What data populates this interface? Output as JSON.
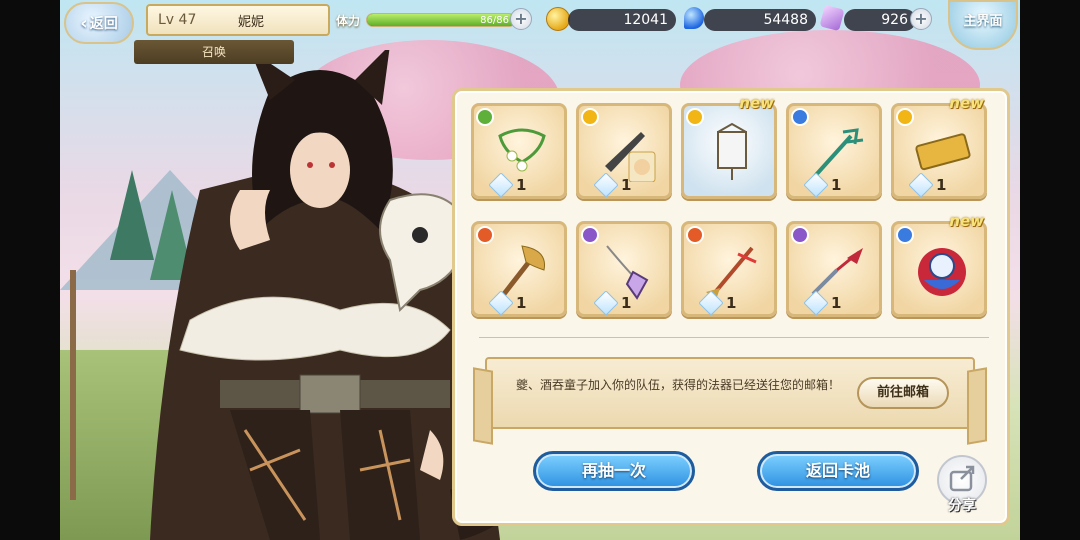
{
  "topbar": {
    "back_label": "返回",
    "level": "Lv 47",
    "player_name": "妮妮",
    "screen_tab": "召唤",
    "stamina_label": "体力",
    "stamina_value": "86/86",
    "stamina_fraction": 1.0,
    "gold": "12041",
    "blue_gems": "54488",
    "crystals": "926",
    "home_label": "主界面"
  },
  "results": {
    "items": [
      {
        "element": "green",
        "icon": "vine-necklace-icon",
        "count": "1",
        "is_new": false,
        "bg": "gold"
      },
      {
        "element": "yellow",
        "icon": "dagger-card-icon",
        "count": "1",
        "is_new": false,
        "bg": "gold"
      },
      {
        "element": "yellow",
        "icon": "lantern-box-icon",
        "count": "",
        "is_new": true,
        "bg": "blue"
      },
      {
        "element": "blue",
        "icon": "trident-icon",
        "count": "1",
        "is_new": false,
        "bg": "gold"
      },
      {
        "element": "yellow",
        "icon": "gold-block-icon",
        "count": "1",
        "is_new": true,
        "bg": "gold"
      },
      {
        "element": "red",
        "icon": "axe-icon",
        "count": "1",
        "is_new": false,
        "bg": "gold"
      },
      {
        "element": "purple",
        "icon": "pendulum-icon",
        "count": "1",
        "is_new": false,
        "bg": "gold"
      },
      {
        "element": "red",
        "icon": "spear-icon",
        "count": "1",
        "is_new": false,
        "bg": "gold"
      },
      {
        "element": "purple",
        "icon": "kunai-icon",
        "count": "1",
        "is_new": false,
        "bg": "gold"
      },
      {
        "element": "blue",
        "icon": "character-portrait-icon",
        "count": "",
        "is_new": true,
        "bg": "gold"
      }
    ],
    "new_label": "new"
  },
  "notice": {
    "message": "夔、酒吞童子加入你的队伍，获得的法器已经送往您的邮箱！",
    "mailbox_button": "前往邮箱"
  },
  "actions": {
    "draw_again": "再抽一次",
    "back_to_pool": "返回卡池",
    "share": "分享"
  },
  "colors": {
    "panel_border": "#e1c98e",
    "button_blue": "#2c8fe0",
    "stamina_green": "#5fae28"
  }
}
